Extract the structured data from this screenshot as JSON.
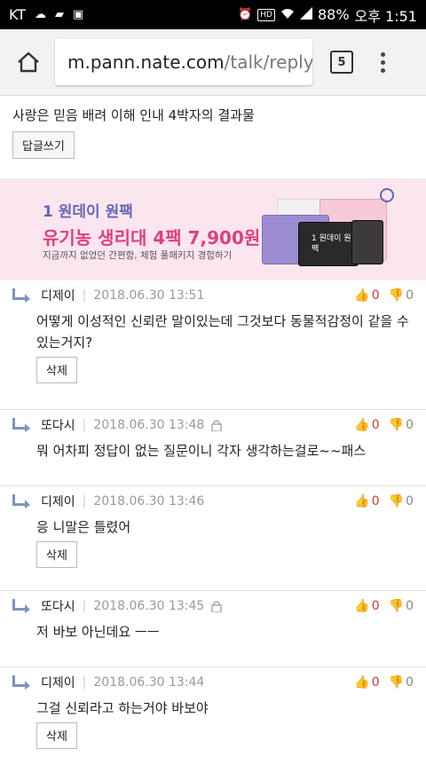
{
  "status_bar": {
    "carrier": "KT",
    "battery": "88%",
    "time": "오후 1:51",
    "hd_label": "HD"
  },
  "browser": {
    "url_host": "m.pann.nate.com",
    "url_path": "/talk/reply",
    "tab_count": "5"
  },
  "post": {
    "title": "사랑은 믿음 배려 이해 인내 4박자의 결과물",
    "reply_button": "답글쓰기"
  },
  "ad": {
    "line1": "1 원데이 원팩",
    "line2": "유기농 생리대 4팩 7,900원",
    "line3": "지금까지 없었던 간편함, 체험 풀패키지 경험하기",
    "pack_label": "1 원데이 원팩"
  },
  "comments": [
    {
      "author": "디제이",
      "date": "2018.06.30 13:51",
      "locked": false,
      "up": "0",
      "down": "0",
      "text": "어떻게 이성적인 신뢰란 말이있는데 그것보다 동물적감정이 같을 수 있는거지?",
      "delete_label": "삭제"
    },
    {
      "author": "또다시",
      "date": "2018.06.30 13:48",
      "locked": true,
      "up": "0",
      "down": "0",
      "text": "뭐 어차피 정답이 없는 질문이니 각자 생각하는걸로~~패스",
      "delete_label": ""
    },
    {
      "author": "디제이",
      "date": "2018.06.30 13:46",
      "locked": false,
      "up": "0",
      "down": "0",
      "text": "응 니말은 틀렸어",
      "delete_label": "삭제"
    },
    {
      "author": "또다시",
      "date": "2018.06.30 13:45",
      "locked": true,
      "up": "0",
      "down": "0",
      "text": "저 바보 아닌데요 ㅡㅡ",
      "delete_label": ""
    },
    {
      "author": "디제이",
      "date": "2018.06.30 13:44",
      "locked": false,
      "up": "0",
      "down": "0",
      "text": "그걸 신뢰라고 하는거야 바보야",
      "delete_label": "삭제"
    }
  ]
}
